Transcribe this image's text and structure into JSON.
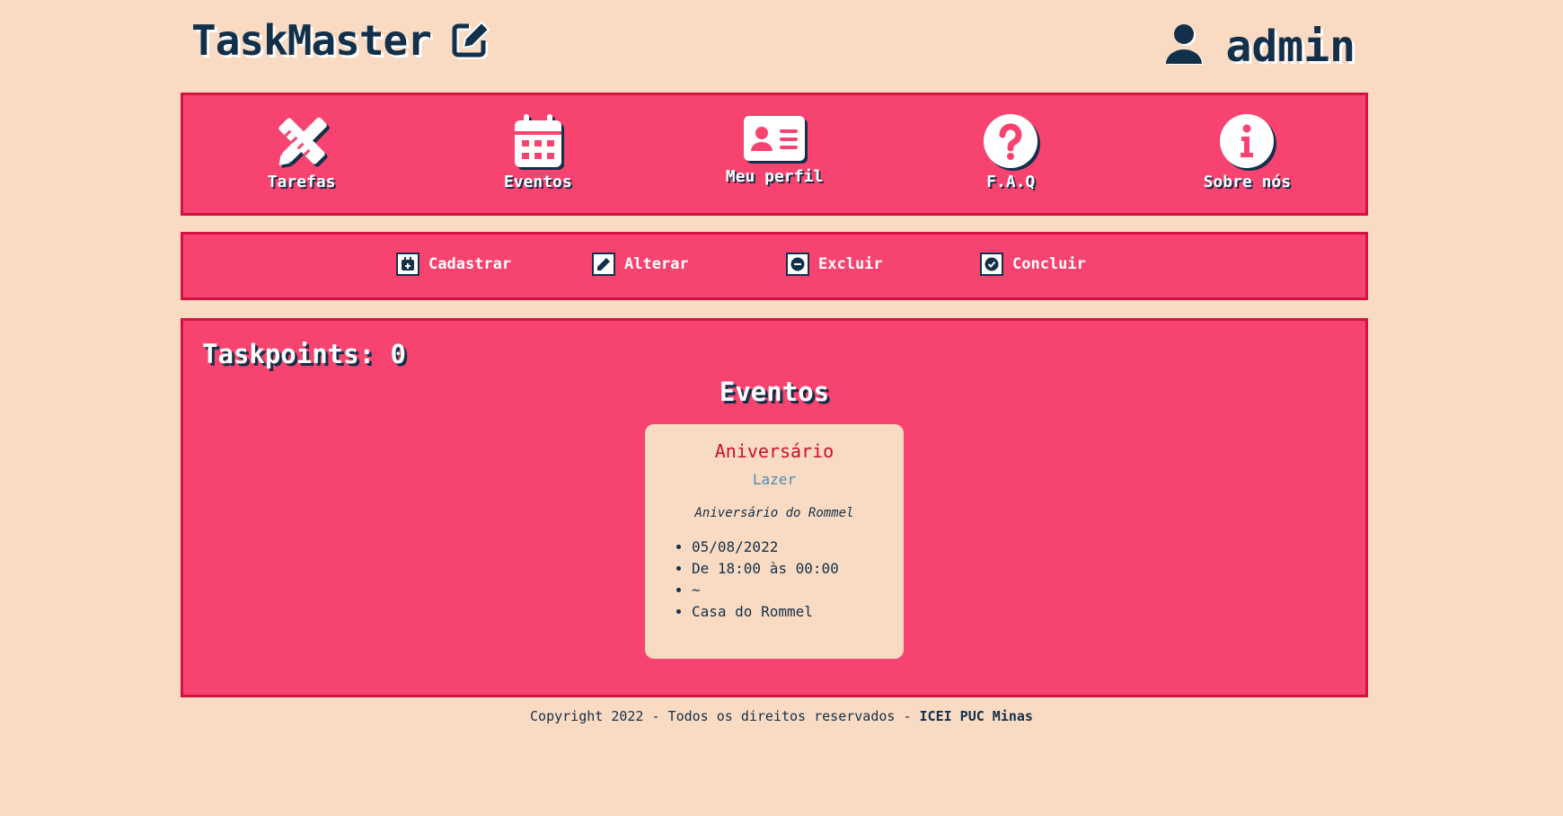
{
  "app": {
    "title": "TaskMaster",
    "user_name": "admin"
  },
  "nav": {
    "items": [
      {
        "label": "Tarefas",
        "icon": "pencil-ruler-icon"
      },
      {
        "label": "Eventos",
        "icon": "calendar-icon"
      },
      {
        "label": "Meu perfil",
        "icon": "id-card-icon"
      },
      {
        "label": "F.A.Q",
        "icon": "question-circle-icon"
      },
      {
        "label": "Sobre nós",
        "icon": "info-circle-icon"
      }
    ]
  },
  "actions": {
    "items": [
      {
        "label": "Cadastrar",
        "icon": "calendar-plus-icon"
      },
      {
        "label": "Alterar",
        "icon": "pencil-icon"
      },
      {
        "label": "Excluir",
        "icon": "minus-circle-icon"
      },
      {
        "label": "Concluir",
        "icon": "check-circle-icon"
      }
    ]
  },
  "content": {
    "taskpoints": "Taskpoints: 0",
    "section_title": "Eventos",
    "event": {
      "title": "Aniversário",
      "category": "Lazer",
      "description": "Aniversário do Rommel",
      "details": [
        "05/08/2022",
        "De 18:00 às 00:00",
        "~",
        "Casa do Rommel"
      ]
    }
  },
  "footer": {
    "text": "Copyright 2022 - Todos os direitos reservados - ",
    "org": "ICEI PUC Minas"
  },
  "colors": {
    "background": "#f9dac2",
    "panel": "#f7436f",
    "panel_border": "#d4123f",
    "navy": "#13304a",
    "event_title": "#c8102e",
    "event_category": "#4a8fb8"
  }
}
